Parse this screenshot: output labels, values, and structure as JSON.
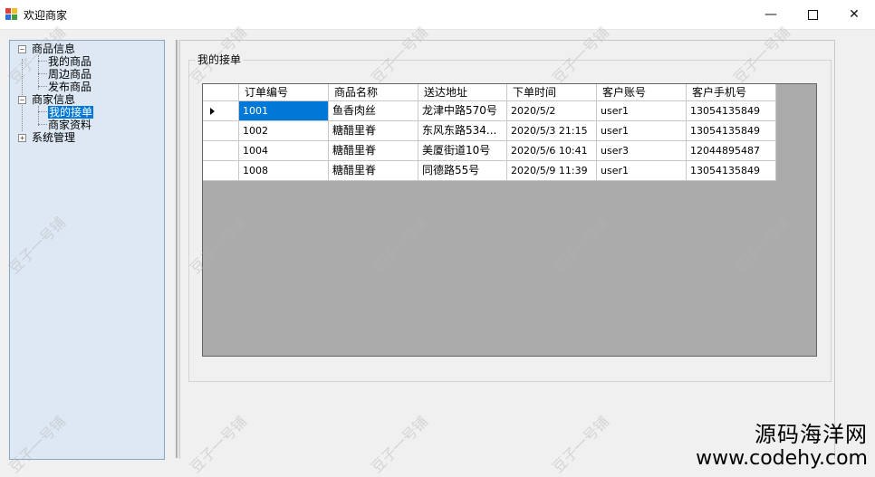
{
  "window": {
    "title": "欢迎商家",
    "minimize_glyph": "—",
    "close_glyph": "✕"
  },
  "tree": {
    "nodes": [
      {
        "label": "商品信息",
        "expander": "−"
      },
      {
        "label": "我的商品"
      },
      {
        "label": "周边商品"
      },
      {
        "label": "发布商品"
      },
      {
        "label": "商家信息",
        "expander": "−"
      },
      {
        "label": "我的接单"
      },
      {
        "label": "商家资料"
      },
      {
        "label": "系统管理",
        "expander": "+"
      }
    ]
  },
  "group": {
    "title": "我的接单"
  },
  "table": {
    "columns": [
      "订单编号",
      "商品名称",
      "送达地址",
      "下单时间",
      "客户账号",
      "客户手机号"
    ],
    "rows": [
      [
        "1001",
        "鱼香肉丝",
        "龙津中路570号",
        "2020/5/2",
        "user1",
        "13054135849"
      ],
      [
        "1002",
        "糖醋里脊",
        "东风东路534...",
        "2020/5/3 21:15",
        "user1",
        "13054135849"
      ],
      [
        "1004",
        "糖醋里脊",
        "美厦街道10号",
        "2020/5/6 10:41",
        "user3",
        "12044895487"
      ],
      [
        "1008",
        "糖醋里脊",
        "同德路55号",
        "2020/5/9 11:39",
        "user1",
        "13054135849"
      ]
    ]
  },
  "watermark": {
    "text": "豆子一号铺"
  },
  "brand": {
    "cn": "源码海洋网",
    "url": "www.codehy.com"
  }
}
